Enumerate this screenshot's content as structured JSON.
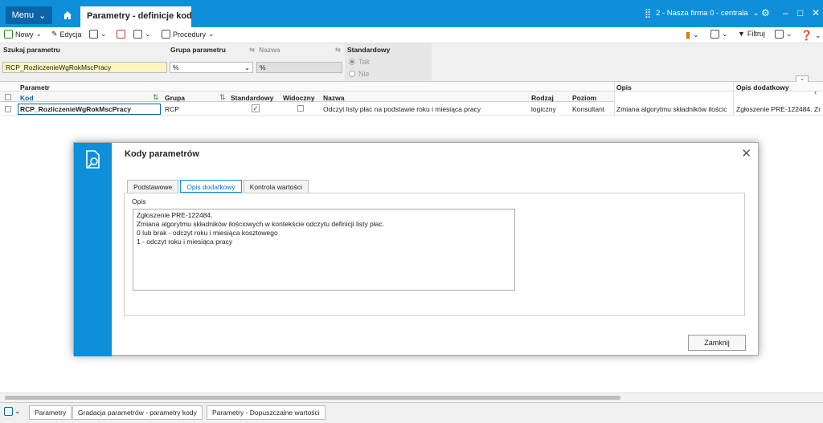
{
  "titlebar": {
    "menu_label": "Menu",
    "tab_title": "Parametry - definicje kodów",
    "firm": "2 - Nasza firma 0 - centrala",
    "accent": "#0f8fd9"
  },
  "toolbar": {
    "new_label": "Nowy",
    "edit_label": "Edycja",
    "procedures_label": "Procedury",
    "filter_label": "Filtruj"
  },
  "filters": {
    "search_label": "Szukaj parametru",
    "search_value": "RCP_RozliczenieWgRokMscPracy",
    "group_label": "Grupa parametru",
    "group_value": "%",
    "name_label": "Nazwa",
    "name_value": "%",
    "standard_label": "Standardowy",
    "opt_yes": "Tak",
    "opt_no": "Nie"
  },
  "grid": {
    "group_header": "Parametr",
    "columns": {
      "kod": "Kod",
      "grupa": "Grupa",
      "standardowy": "Standardowy",
      "widoczny": "Widoczny",
      "nazwa": "Nazwa",
      "rodzaj": "Rodzaj",
      "poziom": "Poziom",
      "opis": "Opis",
      "opis_dod": "Opis dodatkowy"
    },
    "row": {
      "kod": "RCP_RozliczenieWgRokMscPracy",
      "grupa": "RCP",
      "nazwa": "Odczyt listy płac na podstawie roku i miesiąca pracy",
      "rodzaj": "logiczny",
      "poziom": "Konsultant",
      "opis": "Zmiana algorytmu składników ilościc",
      "opis_dod": "Zgłoszenie PRE-122484.",
      "extra": "Zr"
    }
  },
  "dialog": {
    "title": "Kody parametrów",
    "tabs": [
      "Podstawowe",
      "Opis dodatkowy",
      "Kontrola wartości"
    ],
    "opis_label": "Opis",
    "memo": "Zgłoszenie PRE-122484.\nZmiana algorytmu składników ilościowych w kontekście odczytu definicji listy płac.\n0 lub brak - odczyt roku i miesiąca kosztowego\n1 - odczyt roku i miesiąca pracy",
    "close_label": "Zamknij"
  },
  "bottom_tabs": [
    "Parametry",
    "Gradacja parametrów - parametry kody",
    "Parametry - Dopuszczalne wartości"
  ]
}
